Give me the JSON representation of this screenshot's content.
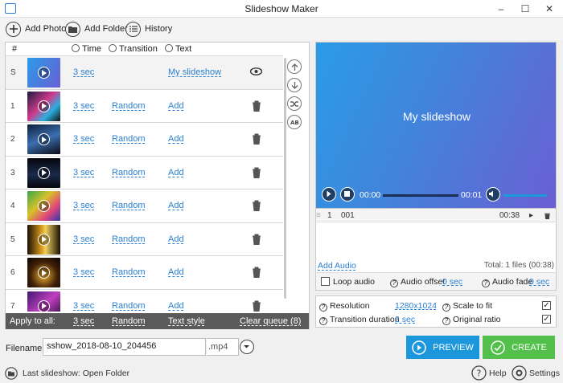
{
  "window": {
    "title": "Slideshow Maker",
    "minimize": "–",
    "maximize": "☐",
    "close": "✕"
  },
  "toolbar": {
    "add_photo": "Add Photo",
    "add_folder": "Add Folder",
    "history": "History"
  },
  "columns": {
    "number": "#",
    "time": "Time",
    "transition": "Transition",
    "text": "Text"
  },
  "rows": [
    {
      "num": "S",
      "time": "3 sec",
      "transition": "",
      "text": "My slideshow",
      "kind": "title"
    },
    {
      "num": "1",
      "time": "3 sec",
      "transition": "Random",
      "text": "Add",
      "kind": "slide"
    },
    {
      "num": "2",
      "time": "3 sec",
      "transition": "Random",
      "text": "Add",
      "kind": "slide"
    },
    {
      "num": "3",
      "time": "3 sec",
      "transition": "Random",
      "text": "Add",
      "kind": "slide"
    },
    {
      "num": "4",
      "time": "3 sec",
      "transition": "Random",
      "text": "Add",
      "kind": "slide"
    },
    {
      "num": "5",
      "time": "3 sec",
      "transition": "Random",
      "text": "Add",
      "kind": "slide"
    },
    {
      "num": "6",
      "time": "3 sec",
      "transition": "Random",
      "text": "Add",
      "kind": "slide"
    },
    {
      "num": "7",
      "time": "3 sec",
      "transition": "Random",
      "text": "Add",
      "kind": "slide"
    }
  ],
  "apply_bar": {
    "label": "Apply to all:",
    "time": "3 sec",
    "transition": "Random",
    "text_style": "Text style",
    "clear_queue": "Clear queue (8)"
  },
  "preview": {
    "title": "My slideshow",
    "current_time": "00:00",
    "end_time": "00:01"
  },
  "audio": {
    "track_index": "1",
    "track_name": "001",
    "track_duration": "00:38",
    "add_audio": "Add Audio",
    "total": "Total: 1 files (00:38)",
    "loop_audio": "Loop audio",
    "audio_offset_label": "Audio offset",
    "audio_offset_value": "0 sec",
    "audio_fade_label": "Audio fade",
    "audio_fade_value": "0 sec"
  },
  "settings": {
    "resolution_label": "Resolution",
    "resolution_value": "1280x1024",
    "transition_duration_label": "Transition duration",
    "transition_duration_value": "2 sec",
    "scale_to_fit": "Scale to fit",
    "original_ratio": "Original ratio"
  },
  "output": {
    "filename_label": "Filename:",
    "filename": "sshow_2018-08-10_204456",
    "extension": ".mp4"
  },
  "actions": {
    "preview": "PREVIEW",
    "create": "CREATE"
  },
  "status": {
    "last_slideshow": "Last slideshow: Open Folder",
    "help": "Help",
    "settings": "Settings"
  },
  "colors": {
    "accent_blue": "#2b7fd1",
    "preview_button": "#1d97dc",
    "create_button": "#53c04b",
    "apply_bar": "#5a5a5a"
  }
}
